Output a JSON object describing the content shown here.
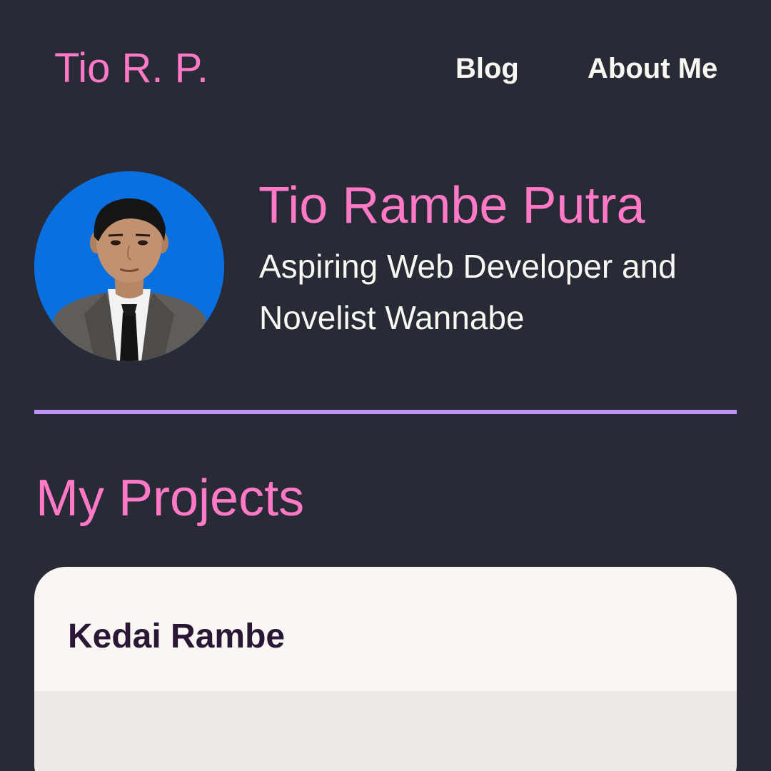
{
  "header": {
    "brand": "Tio R. P.",
    "nav": {
      "blog": "Blog",
      "about": "About Me"
    }
  },
  "profile": {
    "name": "Tio Rambe Putra",
    "tagline": "Aspiring Web Developer and Novelist Wannabe",
    "avatar_alt": "Portrait photo of Tio Rambe Putra"
  },
  "projects": {
    "heading": "My Projects",
    "items": [
      {
        "title": "Kedai Rambe"
      }
    ]
  },
  "colors": {
    "background": "#282a36",
    "accent_pink": "#ff79c6",
    "divider_purple": "#bd93f9",
    "text_light": "#f8f8f2",
    "card_bg": "#faf6f3",
    "card_title": "#2a1735",
    "avatar_bg": "#0a70e0"
  }
}
